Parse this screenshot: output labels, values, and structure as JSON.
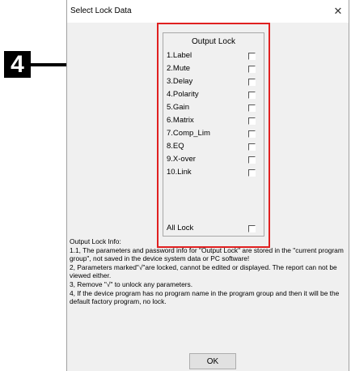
{
  "callout": {
    "number": "4"
  },
  "dialog": {
    "title": "Select Lock Data",
    "close_glyph": "✕",
    "group_title": "Output Lock",
    "items": [
      {
        "label": "1.Label"
      },
      {
        "label": "2.Mute"
      },
      {
        "label": "3.Delay"
      },
      {
        "label": "4.Polarity"
      },
      {
        "label": "5.Gain"
      },
      {
        "label": "6.Matrix"
      },
      {
        "label": "7.Comp_Lim"
      },
      {
        "label": "8.EQ"
      },
      {
        "label": "9.X-over"
      },
      {
        "label": "10.Link"
      }
    ],
    "all_lock": "All Lock",
    "info_lines": [
      "Output Lock Info:",
      "1.1, The parameters and password info for \"Output Lock\" are stored in the \"current program group\", not saved in the device system data or PC software!",
      "2, Parameters marked\"√\"are locked, cannot be edited or displayed. The report can not be viewed  either.",
      "3, Remove \"√\" to unlock any parameters.",
      "4, If the device program has no program name in the program group and then it will be the default factory program, no lock."
    ],
    "ok_label": "OK"
  },
  "colors": {
    "highlight": "#e02020",
    "callout": "#000000",
    "dialog_bg": "#f0f0f0"
  }
}
